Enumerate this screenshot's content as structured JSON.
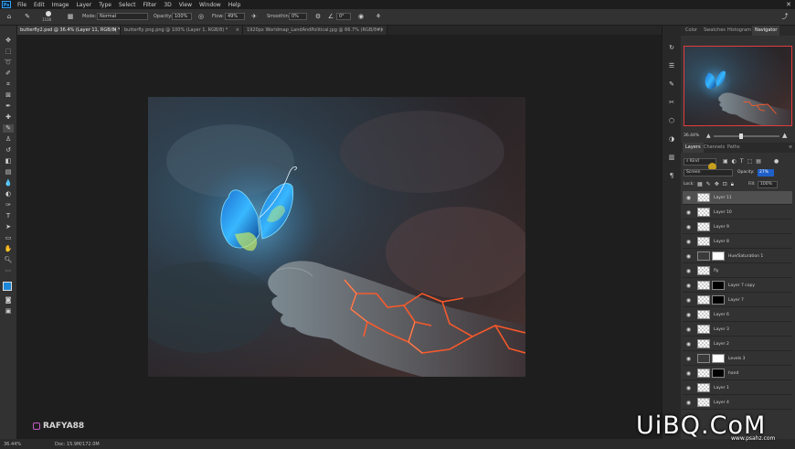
{
  "menu": [
    "File",
    "Edit",
    "Image",
    "Layer",
    "Type",
    "Select",
    "Filter",
    "3D",
    "View",
    "Window",
    "Help"
  ],
  "options_bar": {
    "mode_label": "Mode:",
    "mode_value": "Normal",
    "opacity_label": "Opacity:",
    "opacity_value": "100%",
    "flow_label": "Flow:",
    "flow_value": "49%",
    "smoothing_label": "Smoothing:",
    "smoothing_value": "0%",
    "angle_value": "0°",
    "brush_size": "1100"
  },
  "tabs": [
    {
      "label": "butterfly2.psd @ 36.4% (Layer 11, RGB/8) *",
      "close": "×"
    },
    {
      "label": "butterfly png.png @ 100% (Layer 1, RGB/8) *",
      "close": "×"
    },
    {
      "label": "1920px Worldmap_LandAndPolitical.jpg @ 66.7% (RGB/8#)",
      "close": "×"
    }
  ],
  "panel_top_tabs": [
    "Color",
    "Swatches",
    "Histogram",
    "Navigator"
  ],
  "navigator": {
    "zoom": "36.44%"
  },
  "layers_tabs": [
    "Layers",
    "Channels",
    "Paths"
  ],
  "layers_controls": {
    "kind_label": "Kind",
    "blend_mode": "Screen",
    "opacity_label": "Opacity:",
    "opacity_value": "27%",
    "lock_label": "Lock:",
    "fill_label": "Fill:",
    "fill_value": "100%"
  },
  "layers": [
    {
      "name": "Layer 11",
      "selected": true,
      "mask": false
    },
    {
      "name": "Layer 10",
      "selected": false,
      "mask": false
    },
    {
      "name": "Layer 9",
      "selected": false,
      "mask": false
    },
    {
      "name": "Layer 8",
      "selected": false,
      "mask": false
    },
    {
      "name": "Hue/Saturation 1",
      "selected": false,
      "mask": true,
      "adjustment": true
    },
    {
      "name": "fly",
      "selected": false,
      "mask": false
    },
    {
      "name": "Layer 7 copy",
      "selected": false,
      "mask": true
    },
    {
      "name": "Layer 7",
      "selected": false,
      "mask": true
    },
    {
      "name": "Layer 6",
      "selected": false,
      "mask": false
    },
    {
      "name": "Layer 3",
      "selected": false,
      "mask": false
    },
    {
      "name": "Layer 2",
      "selected": false,
      "mask": false
    },
    {
      "name": "Levels 3",
      "selected": false,
      "mask": true,
      "adjustment": true
    },
    {
      "name": "hand",
      "selected": false,
      "mask": true
    },
    {
      "name": "Layer 1",
      "selected": false,
      "mask": false
    },
    {
      "name": "Layer 4",
      "selected": false,
      "mask": false
    }
  ],
  "status": {
    "zoom": "36.44%",
    "doc": "Doc: 15.9M/172.0M"
  },
  "watermarks": {
    "channel": "RAFYA88",
    "site": "UiBQ.CoM",
    "site_small": "www.psahz.com"
  },
  "colors": {
    "accent": "#2fa3f7",
    "foreground": "#1e88d8",
    "background": "#ffffff",
    "selected_layer": "#505050"
  }
}
